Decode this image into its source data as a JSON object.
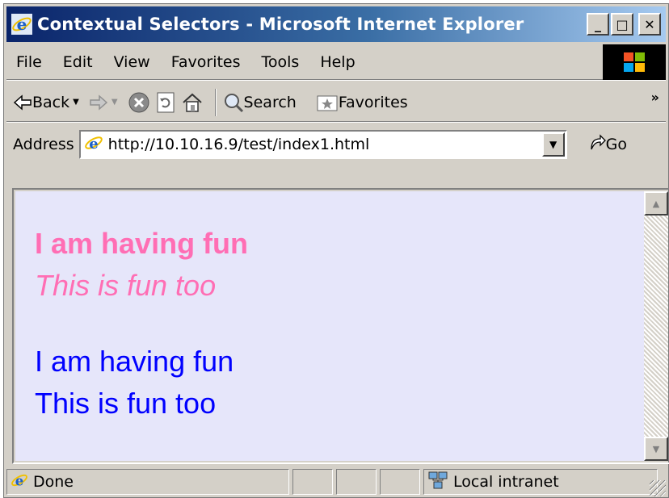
{
  "window": {
    "title": "Contextual Selectors - Microsoft Internet Explorer",
    "minimize": "_",
    "maximize": "□",
    "close": "✕"
  },
  "menu": {
    "items": [
      "File",
      "Edit",
      "View",
      "Favorites",
      "Tools",
      "Help"
    ]
  },
  "toolbar": {
    "back_label": "Back",
    "search_label": "Search",
    "favorites_label": "Favorites",
    "more": "»"
  },
  "address": {
    "label": "Address",
    "url": "http://10.10.16.9/test/index1.html",
    "go_label": "Go"
  },
  "page": {
    "background": "#e6e6fa",
    "lines": [
      {
        "text": "I am having fun",
        "color": "#ff6eb4",
        "style": "bold"
      },
      {
        "text": "This is fun too",
        "color": "#ff6eb4",
        "style": "italic"
      },
      {
        "text": "I am having fun",
        "color": "#0000ff",
        "style": "normal"
      },
      {
        "text": "This is fun too",
        "color": "#0000ff",
        "style": "normal"
      }
    ]
  },
  "status": {
    "text": "Done",
    "zone": "Local intranet"
  }
}
